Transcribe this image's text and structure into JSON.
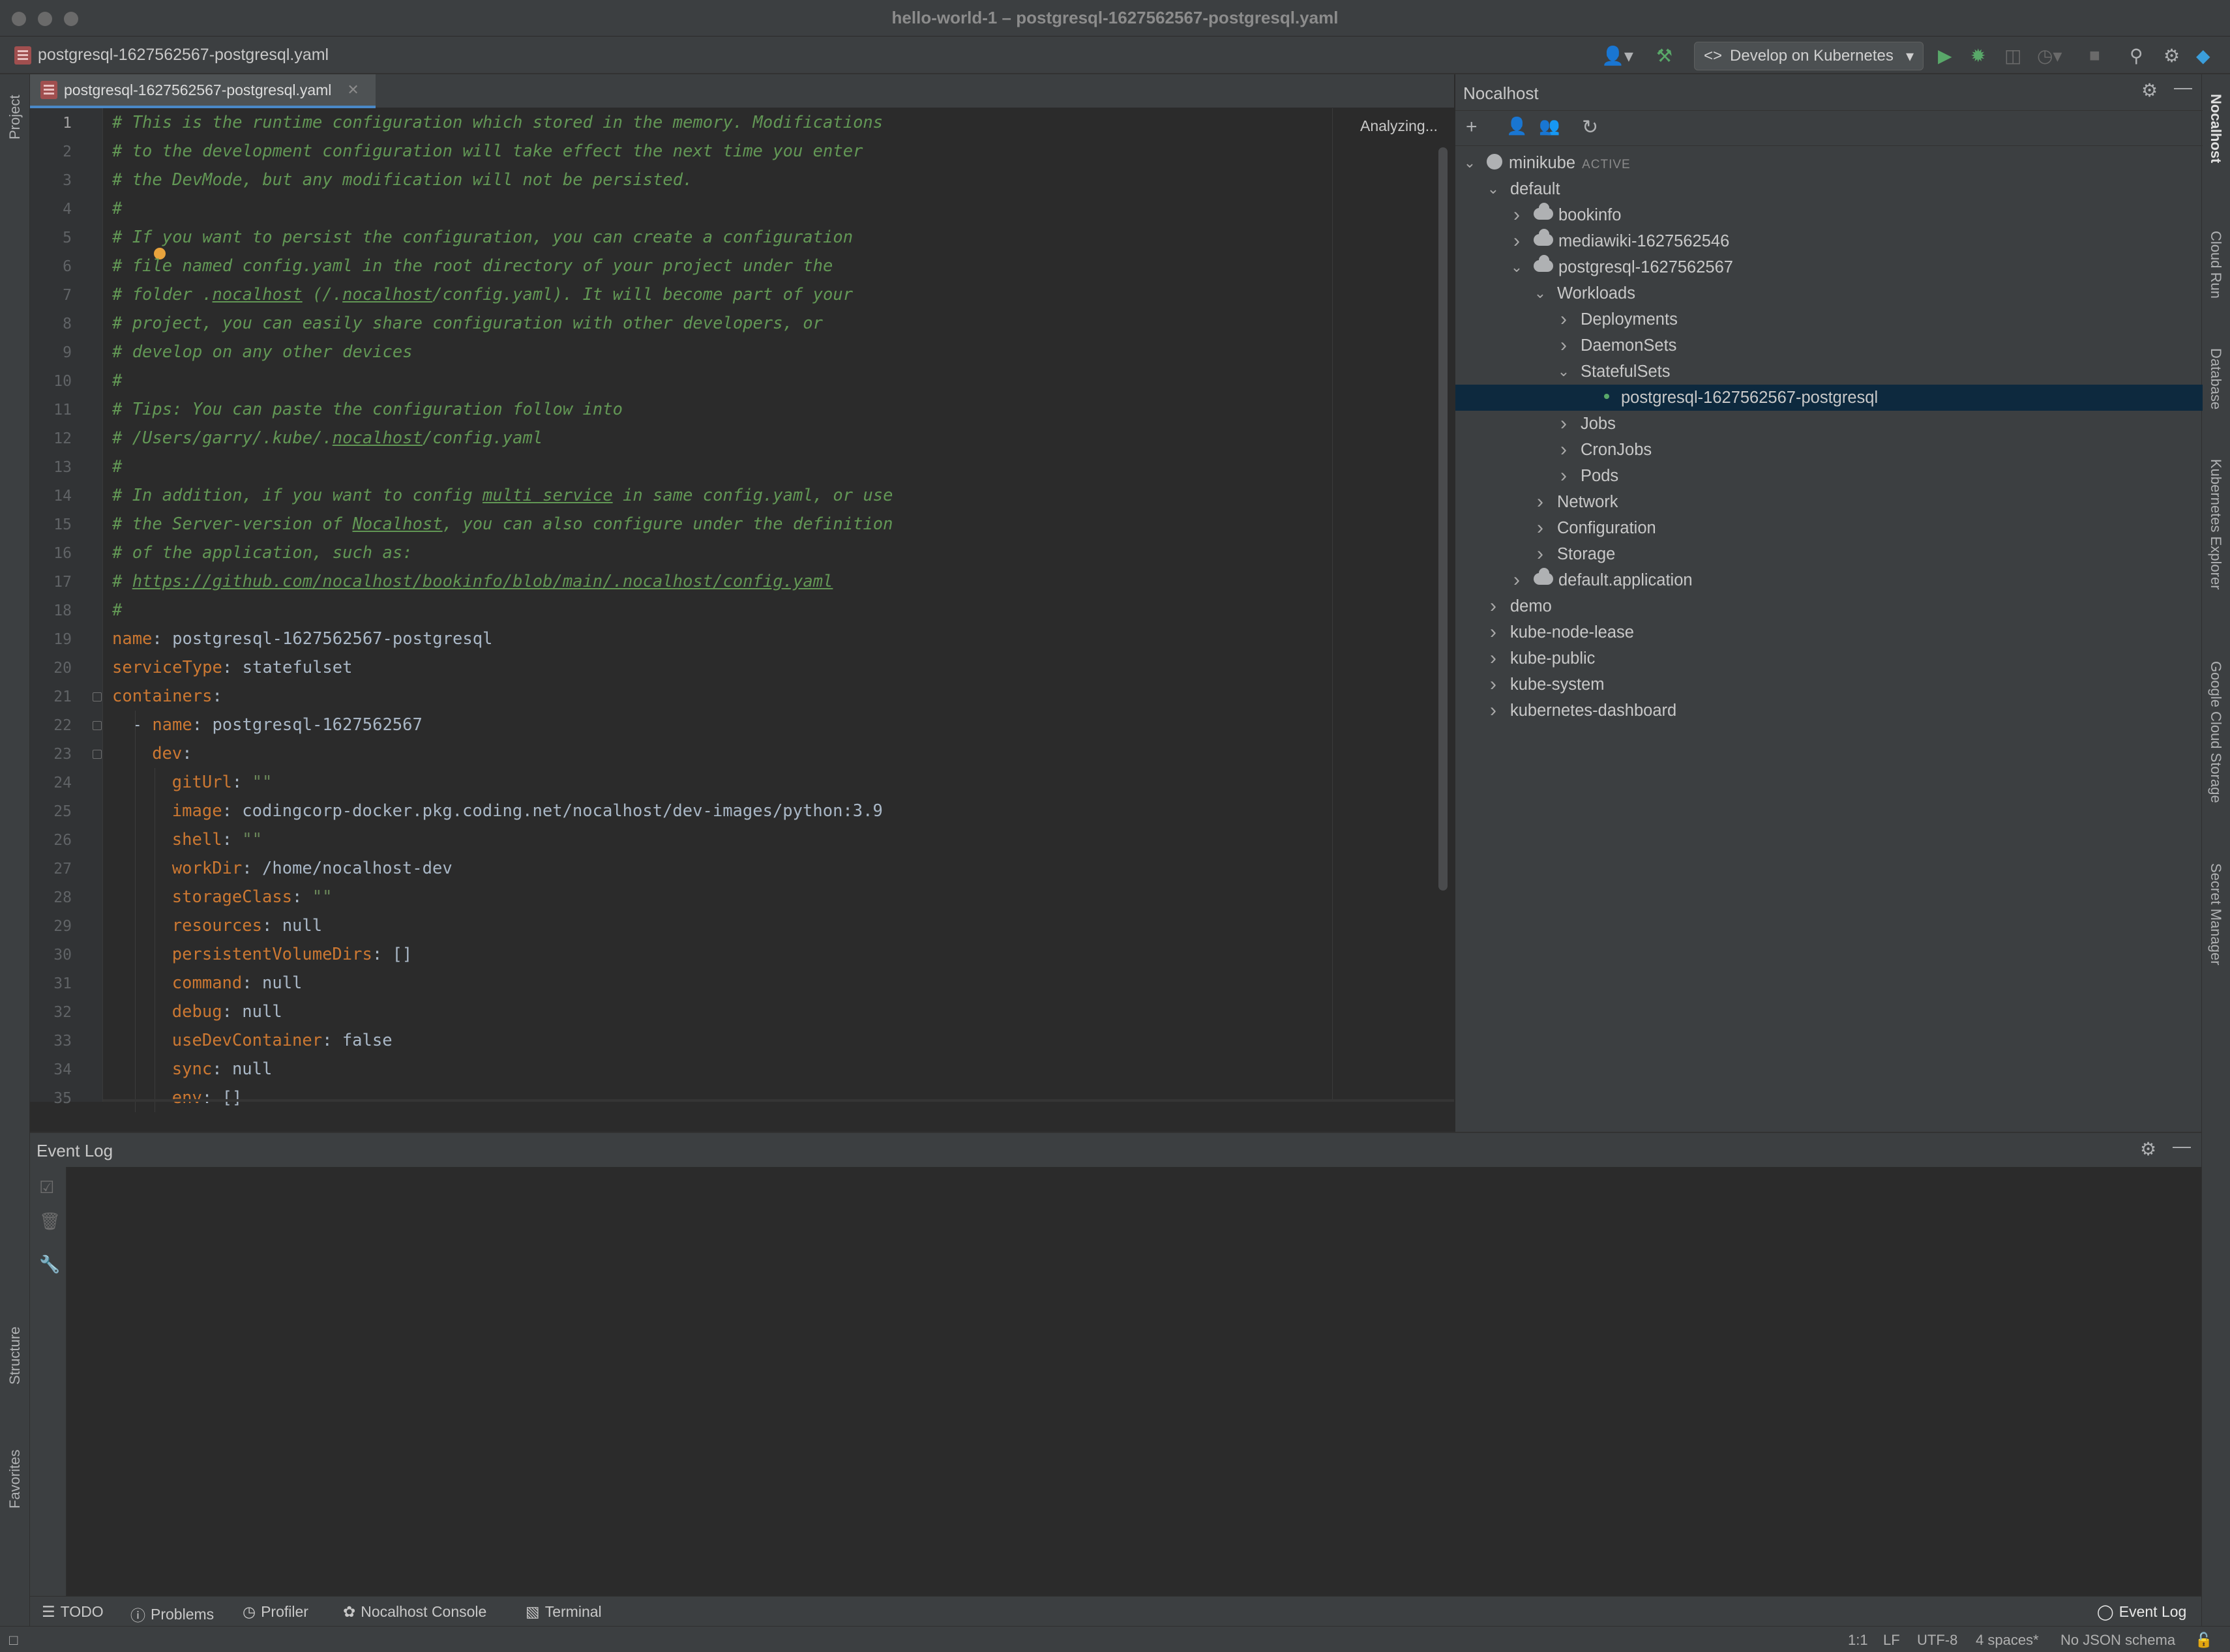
{
  "window": {
    "title": "hello-world-1 – postgresql-1627562567-postgresql.yaml"
  },
  "navbar": {
    "file": "postgresql-1627562567-postgresql.yaml",
    "run_config": "Develop on Kubernetes"
  },
  "left_strip": {
    "project": "Project",
    "structure": "Structure",
    "favorites": "Favorites"
  },
  "right_strip": {
    "items": [
      "Nocalhost",
      "Cloud Run",
      "Database",
      "Kubernetes Explorer",
      "Google Cloud Storage",
      "Secret Manager"
    ]
  },
  "editor": {
    "tab_label": "postgresql-1627562567-postgresql.yaml",
    "status": "Analyzing...",
    "line_numbers": [
      "1",
      "2",
      "3",
      "4",
      "5",
      "6",
      "7",
      "8",
      "9",
      "10",
      "11",
      "12",
      "13",
      "14",
      "15",
      "16",
      "17",
      "18",
      "19",
      "20",
      "21",
      "22",
      "23",
      "24",
      "25",
      "26",
      "27",
      "28",
      "29",
      "30",
      "31",
      "32",
      "33",
      "34",
      "35"
    ],
    "comments": [
      "# This is the runtime configuration which stored in the memory. Modifications",
      "# to the development configuration will take effect the next time you enter",
      "# the DevMode, but any modification will not be persisted.",
      "#",
      "# If you want to persist the configuration, you can create a configuration",
      "# file named config.yaml in the root directory of your project under the",
      "# folder .nocalhost (/.nocalhost/config.yaml). It will become part of your",
      "# project, you can easily share configuration with other developers, or",
      "# develop on any other devices",
      "#",
      "# Tips: You can paste the configuration follow into",
      "# /Users/garry/.kube/.nocalhost/config.yaml",
      "#",
      "# In addition, if you want to config multi service in same config.yaml, or use",
      "# the Server-version of Nocalhost, you can also configure under the definition",
      "# of the application, such as:",
      "# https://github.com/nocalhost/bookinfo/blob/main/.nocalhost/config.yaml",
      "#"
    ],
    "yaml": [
      {
        "key": "name",
        "sep": ": ",
        "val": "postgresql-1627562567-postgresql"
      },
      {
        "key": "serviceType",
        "sep": ": ",
        "val": "statefulset"
      },
      {
        "key": "containers",
        "sep": ":",
        "val": ""
      },
      {
        "dash": "- ",
        "key": "name",
        "sep": ": ",
        "val": "postgresql-1627562567"
      },
      {
        "key": "dev",
        "sep": ":",
        "val": ""
      },
      {
        "key": "gitUrl",
        "sep": ": ",
        "str": "\"\""
      },
      {
        "key": "image",
        "sep": ": ",
        "val": "codingcorp-docker.pkg.coding.net/nocalhost/dev-images/python:3.9"
      },
      {
        "key": "shell",
        "sep": ": ",
        "str": "\"\""
      },
      {
        "key": "workDir",
        "sep": ": ",
        "val": "/home/nocalhost-dev"
      },
      {
        "key": "storageClass",
        "sep": ": ",
        "str": "\"\""
      },
      {
        "key": "resources",
        "sep": ": ",
        "val": "null"
      },
      {
        "key": "persistentVolumeDirs",
        "sep": ": ",
        "val": "[]"
      },
      {
        "key": "command",
        "sep": ": ",
        "val": "null"
      },
      {
        "key": "debug",
        "sep": ": ",
        "val": "null"
      },
      {
        "key": "useDevContainer",
        "sep": ": ",
        "val": "false"
      },
      {
        "key": "sync",
        "sep": ": ",
        "val": "null"
      },
      {
        "key": "env",
        "sep": ": ",
        "val": "[]"
      }
    ]
  },
  "nocalhost": {
    "title": "Nocalhost",
    "tree": [
      {
        "label": "minikube",
        "badge": "ACTIVE"
      },
      {
        "label": "default"
      },
      {
        "label": "bookinfo"
      },
      {
        "label": "mediawiki-1627562546"
      },
      {
        "label": "postgresql-1627562567"
      },
      {
        "label": "Workloads"
      },
      {
        "label": "Deployments"
      },
      {
        "label": "DaemonSets"
      },
      {
        "label": "StatefulSets"
      },
      {
        "label": "postgresql-1627562567-postgresql"
      },
      {
        "label": "Jobs"
      },
      {
        "label": "CronJobs"
      },
      {
        "label": "Pods"
      },
      {
        "label": "Network"
      },
      {
        "label": "Configuration"
      },
      {
        "label": "Storage"
      },
      {
        "label": "default.application"
      },
      {
        "label": "demo"
      },
      {
        "label": "kube-node-lease"
      },
      {
        "label": "kube-public"
      },
      {
        "label": "kube-system"
      },
      {
        "label": "kubernetes-dashboard"
      }
    ]
  },
  "event_log": {
    "title": "Event Log"
  },
  "bottom_tabs": {
    "todo": "TODO",
    "problems": "Problems",
    "profiler": "Profiler",
    "console": "Nocalhost Console",
    "terminal": "Terminal",
    "event_log": "Event Log"
  },
  "status": {
    "position": "1:1",
    "line_sep": "LF",
    "encoding": "UTF-8",
    "indent": "4 spaces*",
    "schema": "No JSON schema"
  }
}
